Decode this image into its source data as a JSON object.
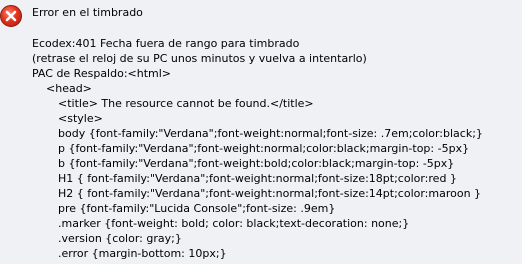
{
  "dialog": {
    "icon": "error-icon",
    "title": "Error en el timbrado",
    "message_lines": [
      "Ecodex:401 Fecha fuera de rango para timbrado",
      "(retrase el reloj de su PC unos minutos y vuelva a intentarlo)",
      "PAC de Respaldo:<html>"
    ],
    "html_lines": [
      "<head>",
      "<title> The resource cannot be found.</title>",
      "<style>",
      "body {font-family:\"Verdana\";font-weight:normal;font-size: .7em;color:black;}",
      "p {font-family:\"Verdana\";font-weight:normal;color:black;margin-top: -5px}",
      "b {font-family:\"Verdana\";font-weight:bold;color:black;margin-top: -5px}",
      "H1 { font-family:\"Verdana\";font-weight:normal;font-size:18pt;color:red }",
      "H2 { font-family:\"Verdana\";font-weight:normal;font-size:14pt;color:maroon }",
      "pre {font-family:\"Lucida Console\";font-size: .9em}",
      ".marker {font-weight: bold; color: black;text-decoration: none;}",
      ".version {color: gray;}",
      ".error {margin-bottom: 10px;}"
    ]
  }
}
